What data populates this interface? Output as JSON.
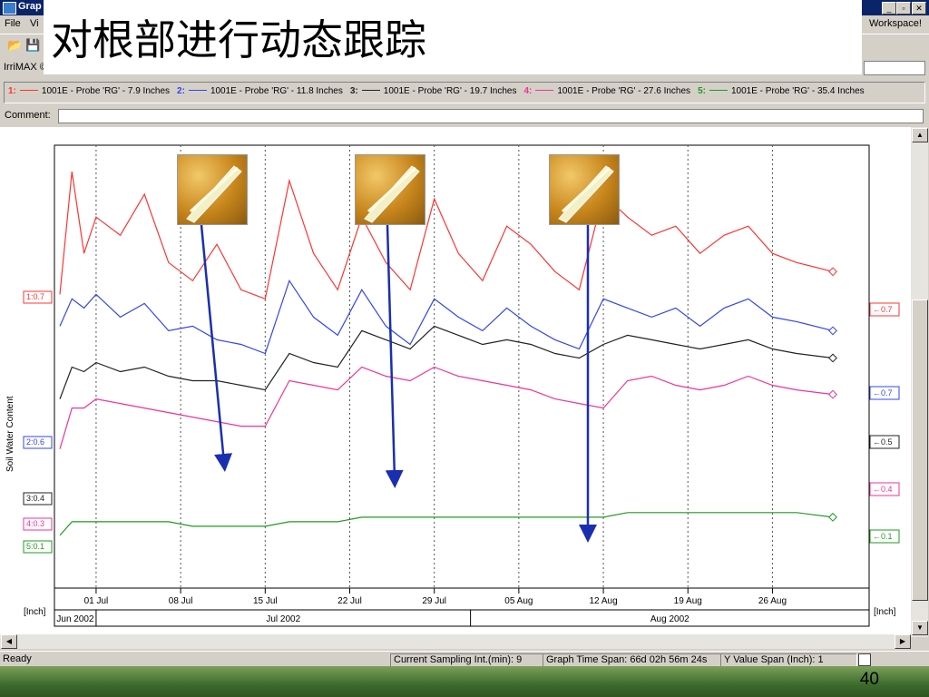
{
  "window": {
    "title": "Grap"
  },
  "slide": {
    "title": "对根部进行动态跟踪",
    "page_number": "40"
  },
  "menu": {
    "items": [
      "File",
      "Vi"
    ],
    "workspace": "Workspace!"
  },
  "toolbar": {
    "icons": [
      "open-folder-icon",
      "save-icon"
    ]
  },
  "probe_bar": {
    "label": "IrriMAX ©"
  },
  "legend": [
    {
      "num": "1:",
      "color": "#ff3333",
      "label": "1001E - Probe 'RG' - 7.9 Inches"
    },
    {
      "num": "2:",
      "color": "#3344ee",
      "label": "1001E - Probe 'RG' - 11.8 Inches"
    },
    {
      "num": "3:",
      "color": "#222222",
      "label": "1001E - Probe 'RG' - 19.7 Inches"
    },
    {
      "num": "4:",
      "color": "#ee3399",
      "label": "1001E - Probe 'RG' - 27.6 Inches"
    },
    {
      "num": "5:",
      "color": "#229922",
      "label": "1001E - Probe 'RG' - 35.4 Inches"
    }
  ],
  "comment": {
    "label": "Comment:",
    "value": ""
  },
  "chart_data": {
    "type": "line",
    "ylabel": "Soil Water Content",
    "xlabel_unit_left": "[Inch]",
    "xlabel_unit_right": "[Inch]",
    "x_ticks": [
      "01 Jul",
      "08 Jul",
      "15 Jul",
      "22 Jul",
      "29 Jul",
      "05 Aug",
      "12 Aug",
      "19 Aug",
      "26 Aug"
    ],
    "months": [
      "Jun 2002",
      "Jul 2002",
      "Aug 2002"
    ],
    "left_labels": [
      {
        "text": "1:0.7",
        "color": "#ff3333"
      },
      {
        "text": "2:0.6",
        "color": "#3344ee"
      },
      {
        "text": "3:0.4",
        "color": "#222222"
      },
      {
        "text": "4:0.3",
        "color": "#ee3399"
      },
      {
        "text": "5:0.1",
        "color": "#229922"
      }
    ],
    "right_labels": [
      {
        "text": "0.7",
        "color": "#ff3333"
      },
      {
        "text": "0.7",
        "color": "#3344ee"
      },
      {
        "text": "0.5",
        "color": "#222222"
      },
      {
        "text": "0.4",
        "color": "#ee3399"
      },
      {
        "text": "0.1",
        "color": "#229922"
      }
    ],
    "x": [
      "06-28",
      "06-29",
      "06-30",
      "07-01",
      "07-03",
      "07-05",
      "07-07",
      "07-09",
      "07-11",
      "07-13",
      "07-15",
      "07-17",
      "07-19",
      "07-21",
      "07-23",
      "07-25",
      "07-27",
      "07-29",
      "07-31",
      "08-02",
      "08-04",
      "08-06",
      "08-08",
      "08-10",
      "08-12",
      "08-14",
      "08-16",
      "08-18",
      "08-20",
      "08-22",
      "08-24",
      "08-26",
      "08-28",
      "08-31"
    ],
    "series": [
      {
        "name": "1:",
        "color": "#ff3333",
        "values": [
          0.63,
          0.9,
          0.72,
          0.8,
          0.76,
          0.85,
          0.7,
          0.66,
          0.74,
          0.64,
          0.62,
          0.88,
          0.72,
          0.64,
          0.8,
          0.7,
          0.64,
          0.84,
          0.72,
          0.66,
          0.78,
          0.74,
          0.68,
          0.64,
          0.85,
          0.8,
          0.76,
          0.78,
          0.72,
          0.76,
          0.78,
          0.72,
          0.7,
          0.68
        ]
      },
      {
        "name": "2:",
        "color": "#3344ee",
        "values": [
          0.56,
          0.62,
          0.6,
          0.63,
          0.58,
          0.61,
          0.55,
          0.56,
          0.53,
          0.52,
          0.5,
          0.66,
          0.58,
          0.54,
          0.64,
          0.56,
          0.52,
          0.62,
          0.58,
          0.55,
          0.6,
          0.56,
          0.53,
          0.51,
          0.62,
          0.6,
          0.58,
          0.6,
          0.56,
          0.6,
          0.62,
          0.58,
          0.57,
          0.55
        ]
      },
      {
        "name": "3:",
        "color": "#222222",
        "values": [
          0.4,
          0.47,
          0.46,
          0.48,
          0.46,
          0.47,
          0.45,
          0.44,
          0.44,
          0.43,
          0.42,
          0.5,
          0.48,
          0.47,
          0.55,
          0.53,
          0.51,
          0.56,
          0.54,
          0.52,
          0.53,
          0.52,
          0.5,
          0.49,
          0.52,
          0.54,
          0.53,
          0.52,
          0.51,
          0.52,
          0.53,
          0.51,
          0.5,
          0.49
        ]
      },
      {
        "name": "4:",
        "color": "#ee3399",
        "values": [
          0.29,
          0.38,
          0.38,
          0.4,
          0.39,
          0.38,
          0.37,
          0.36,
          0.35,
          0.34,
          0.34,
          0.44,
          0.43,
          0.42,
          0.47,
          0.45,
          0.44,
          0.47,
          0.45,
          0.44,
          0.43,
          0.42,
          0.4,
          0.39,
          0.38,
          0.44,
          0.45,
          0.43,
          0.42,
          0.43,
          0.45,
          0.43,
          0.42,
          0.41
        ]
      },
      {
        "name": "5:",
        "color": "#229922",
        "values": [
          0.1,
          0.13,
          0.13,
          0.13,
          0.13,
          0.13,
          0.13,
          0.12,
          0.12,
          0.12,
          0.12,
          0.13,
          0.13,
          0.13,
          0.14,
          0.14,
          0.14,
          0.14,
          0.14,
          0.14,
          0.14,
          0.14,
          0.14,
          0.14,
          0.14,
          0.15,
          0.15,
          0.15,
          0.15,
          0.15,
          0.15,
          0.15,
          0.15,
          0.14
        ]
      }
    ],
    "annotation_arrow_color": "#1a2fb0",
    "ylim": [
      0.0,
      0.95
    ],
    "grid": "vertical-dotted"
  },
  "status": {
    "ready": "Ready",
    "sampling": "Current Sampling Int.(min):  9",
    "timespan": "Graph Time Span:  66d 02h 56m 24s",
    "yspan": "Y Value Span (Inch):  1"
  }
}
